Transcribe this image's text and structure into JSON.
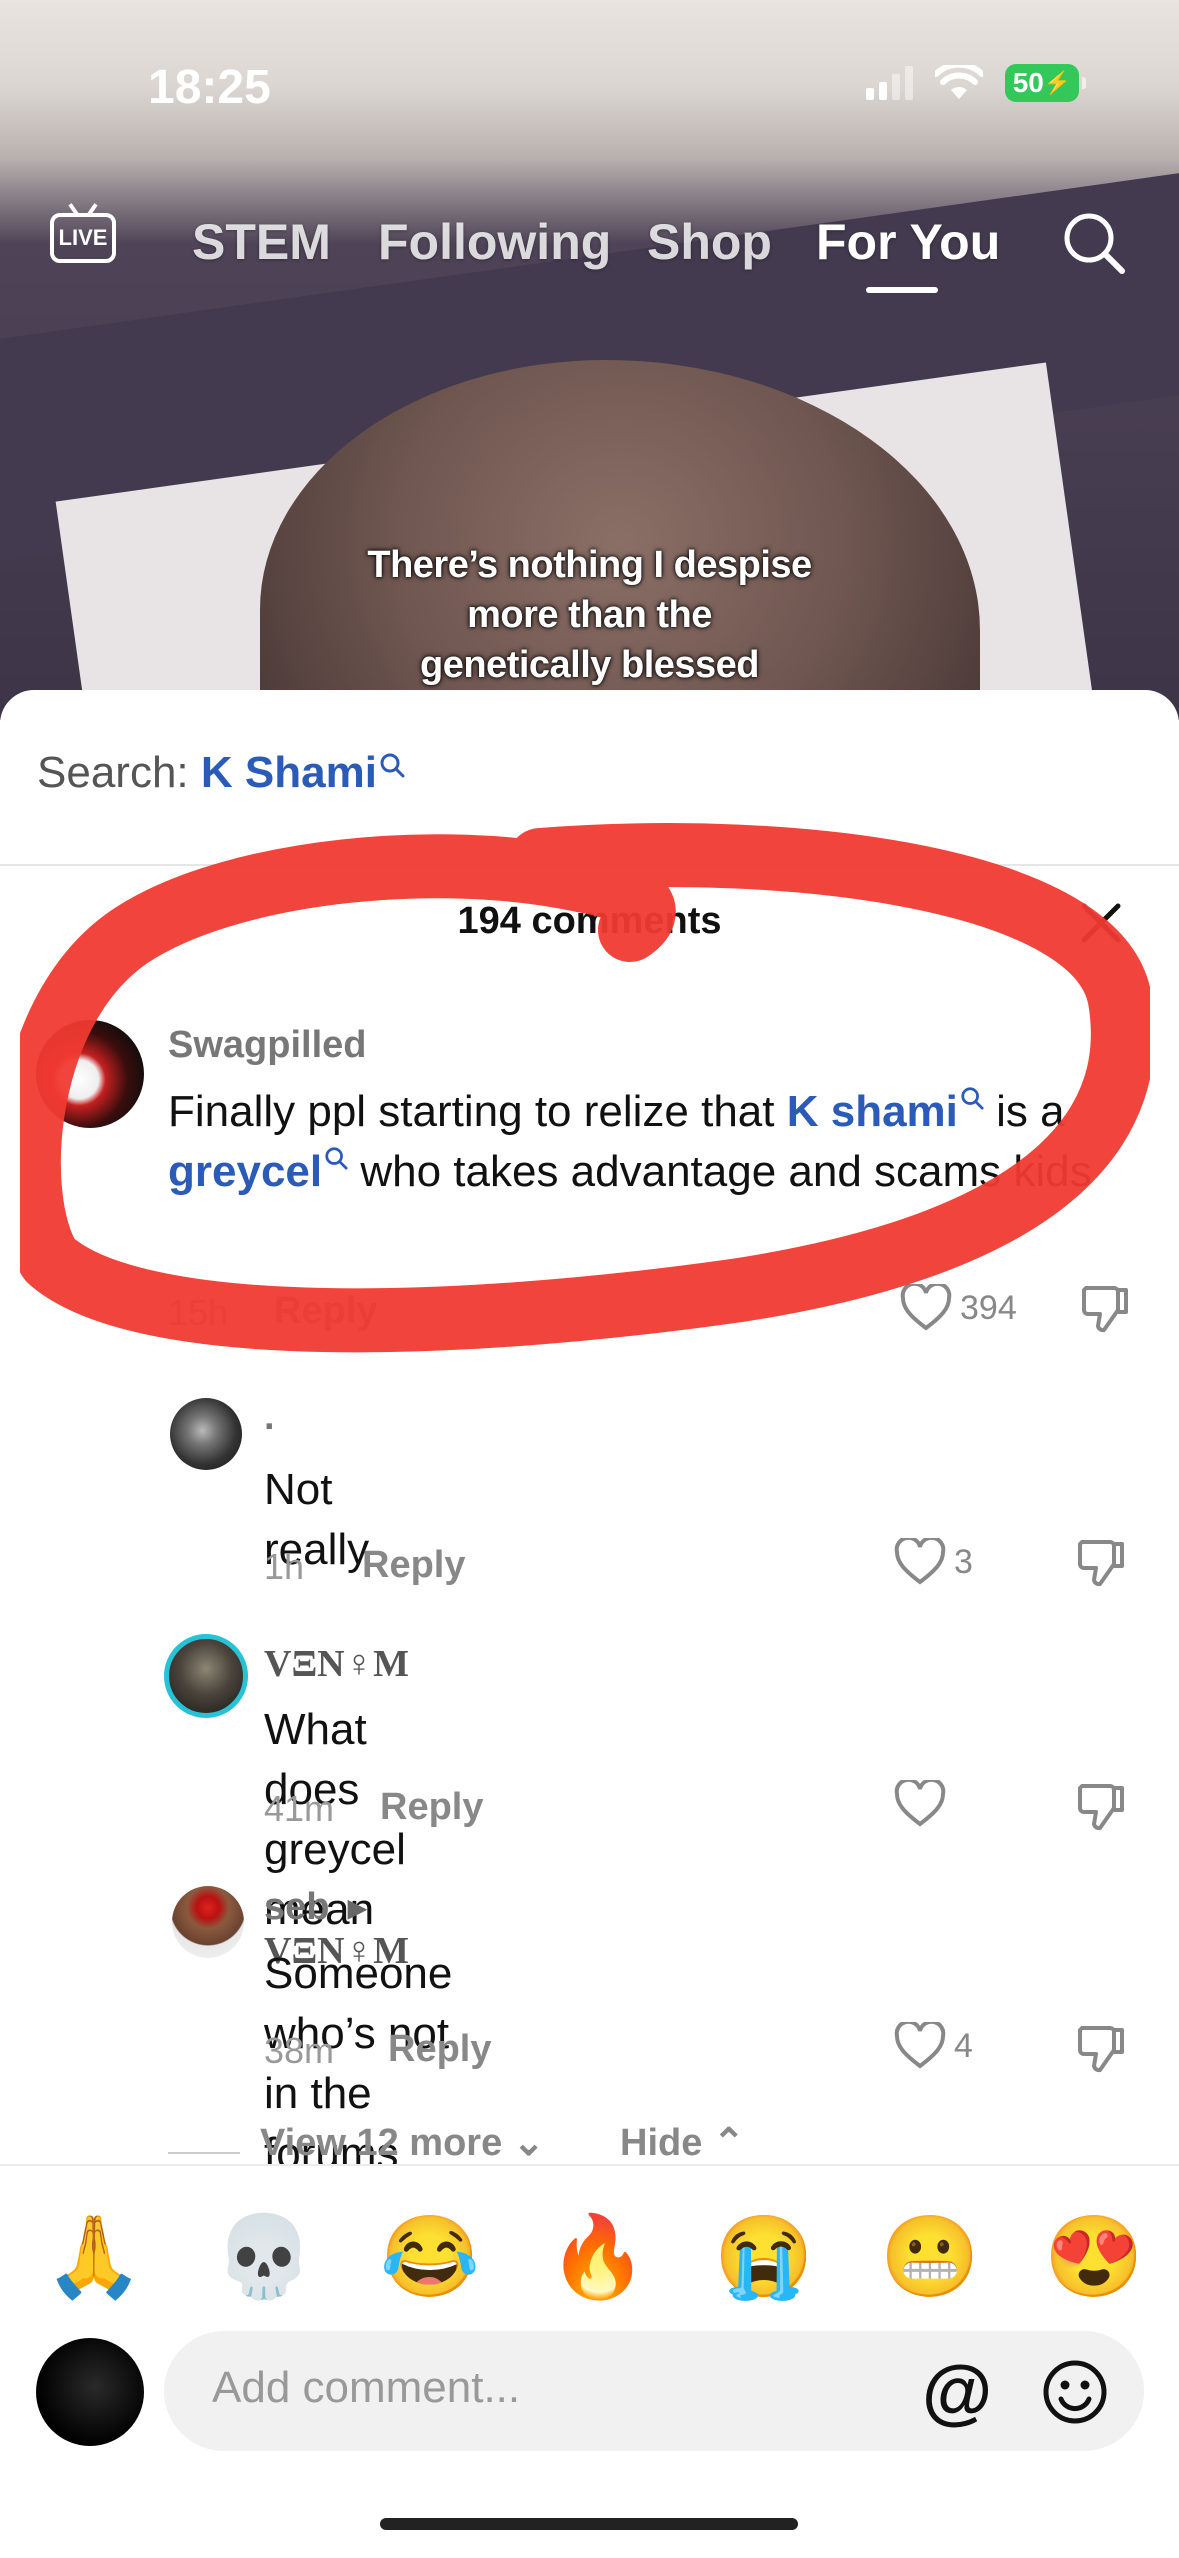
{
  "status": {
    "time": "18:25",
    "battery": "50"
  },
  "topnav": {
    "live_label": "LIVE",
    "tabs": [
      {
        "label": "STEM"
      },
      {
        "label": "Following"
      },
      {
        "label": "Shop"
      },
      {
        "label": "For You",
        "active": true
      }
    ]
  },
  "video": {
    "caption_lines": [
      "There’s nothing I despise",
      "more than the",
      "genetically blessed"
    ]
  },
  "sheet": {
    "search_prefix": "Search: ",
    "search_term": "K Shami",
    "comment_count": "194 comments"
  },
  "comments": [
    {
      "username": "Swagpilled",
      "text_parts": [
        "Finally ppl starting to relize that ",
        "K shami",
        " is a ",
        "greycel",
        " who takes advantage and scams kids"
      ],
      "time": "15h",
      "reply": "Reply",
      "likes": "394"
    },
    {
      "username": ".",
      "text": "Not really",
      "time": "1h",
      "reply": "Reply",
      "likes": "3"
    },
    {
      "username": "VΞN♀M",
      "text": "What does greycel mean",
      "time": "41m",
      "reply": "Reply",
      "likes": ""
    },
    {
      "username": "seb",
      "reply_to": "VΞN♀M",
      "text": "Someone who’s not in the forums",
      "time": "38m",
      "reply": "Reply",
      "likes": "4"
    }
  ],
  "thread": {
    "view_more": "View 12 more",
    "hide": "Hide"
  },
  "composer": {
    "emojis": [
      "🙏",
      "💀",
      "😂",
      "🔥",
      "😭",
      "😬",
      "😍"
    ],
    "placeholder": "Add comment...",
    "at_symbol": "@"
  },
  "colors": {
    "link": "#2b5bb8",
    "annotation": "#f03a32",
    "battery": "#34c759"
  }
}
